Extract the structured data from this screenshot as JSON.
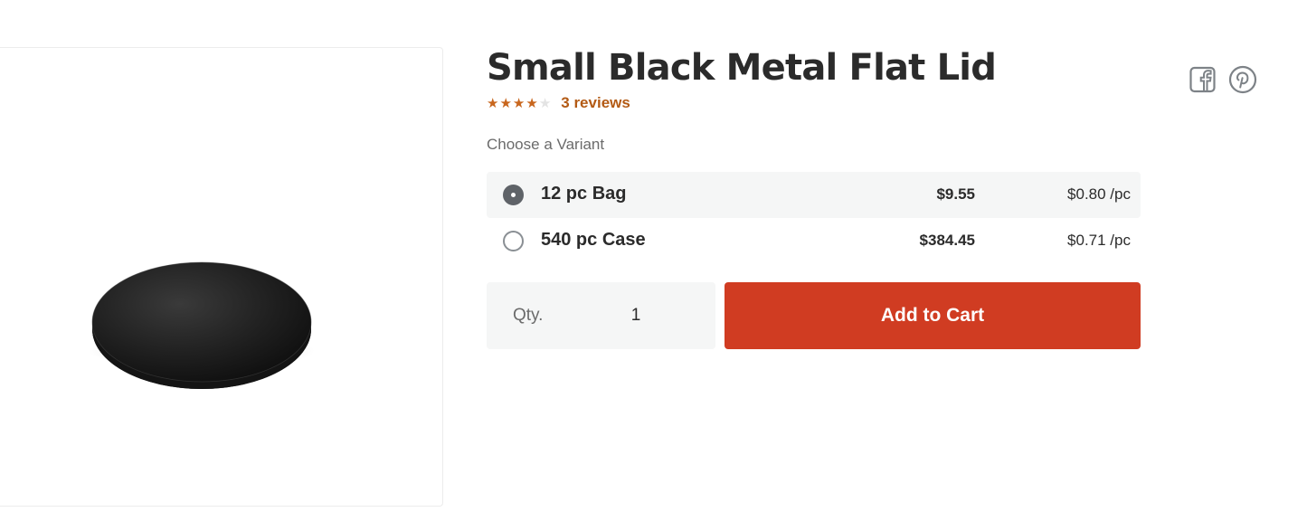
{
  "product": {
    "title": "Small Black Metal Flat Lid",
    "image_alt": "Small black metal flat lid",
    "rating": 4,
    "rating_max": 5,
    "reviews_label": "3 reviews"
  },
  "social": [
    {
      "icon": "facebook-icon"
    },
    {
      "icon": "pinterest-icon"
    }
  ],
  "variants": {
    "label": "Choose a Variant",
    "options": [
      {
        "name": "12 pc Bag",
        "price": "$9.55",
        "unit_price": "$0.80 /pc",
        "selected": true
      },
      {
        "name": "540 pc Case",
        "price": "$384.45",
        "unit_price": "$0.71 /pc",
        "selected": false
      }
    ]
  },
  "quantity": {
    "label": "Qty.",
    "value": "1"
  },
  "add_to_cart": {
    "label": "Add to Cart"
  },
  "colors": {
    "accent": "#d03c22",
    "star": "#c8661d",
    "reviews_link": "#b35a14",
    "selected_bg": "#f5f6f6"
  }
}
